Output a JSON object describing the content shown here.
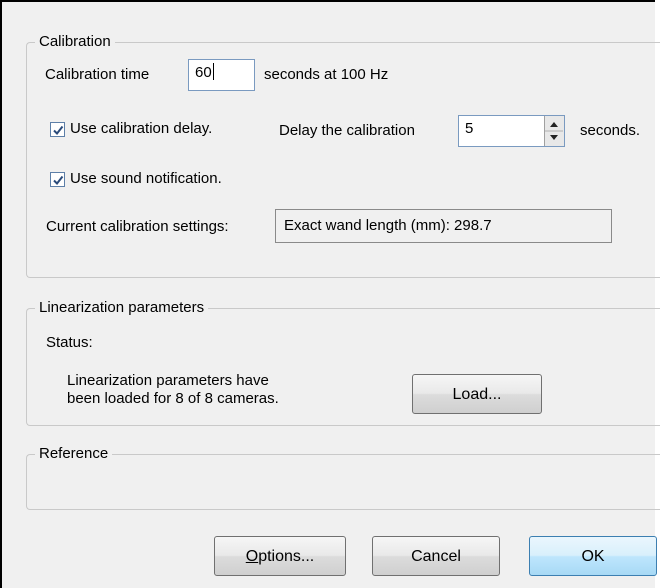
{
  "calibration": {
    "title": "Calibration",
    "time_label": "Calibration time",
    "time_value": "60",
    "time_suffix": "seconds at  100 Hz",
    "use_delay_label": "Use calibration delay.",
    "delay_label": "Delay the calibration",
    "delay_value": "5",
    "delay_suffix": "seconds.",
    "use_sound_label": "Use sound notification.",
    "current_settings_label": "Current calibration settings:",
    "current_settings_value": "Exact wand length (mm): 298.7",
    "use_delay_checked": true,
    "use_sound_checked": true
  },
  "linearization": {
    "title": "Linearization parameters",
    "status_label": "Status:",
    "status_line1": "Linearization parameters have",
    "status_line2": "been loaded for 8 of 8 cameras.",
    "load_button": "Load..."
  },
  "reference": {
    "title": "Reference"
  },
  "buttons": {
    "options": "Options...",
    "cancel": "Cancel",
    "ok": "OK"
  },
  "colors": {
    "panel_bg": "#f0f0f0",
    "ok_accent": "#3c7fb1"
  }
}
